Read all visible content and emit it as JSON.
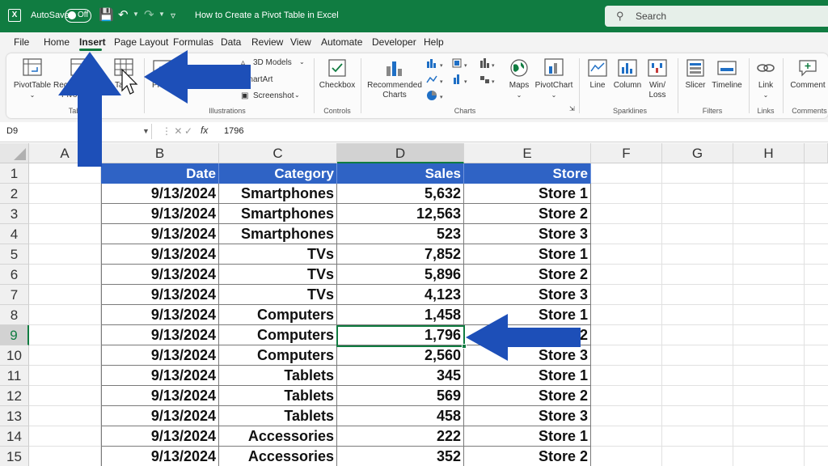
{
  "titlebar": {
    "autosave_label": "AutoSave",
    "toggle_state": "Off",
    "document_title": "How to Create a Pivot Table in Excel",
    "search_placeholder": "Search",
    "accent_color": "#107c41"
  },
  "menu": {
    "tabs": [
      "File",
      "Home",
      "Insert",
      "Page Layout",
      "Formulas",
      "Data",
      "Review",
      "View",
      "Automate",
      "Developer",
      "Help"
    ],
    "active_tab": "Insert"
  },
  "ribbon": {
    "tables": {
      "pivottable": "PivotTable",
      "recommended_pivot_1": "Rec",
      "recommended_pivot_2": "Pivot",
      "table": "Ta",
      "group": "Tab"
    },
    "illustrations": {
      "pictures": "Pi",
      "models_3d": "3D Models",
      "smartart": "SmartArt",
      "screenshot": "Screenshot",
      "group": "Illustrations"
    },
    "controls": {
      "checkbox": "Checkbox",
      "group": "Controls"
    },
    "charts": {
      "recommended_1": "Recommended",
      "recommended_2": "Charts",
      "maps": "Maps",
      "pivotchart": "PivotChart",
      "group": "Charts"
    },
    "sparklines": {
      "line": "Line",
      "column": "Column",
      "winloss_1": "Win/",
      "winloss_2": "Loss",
      "group": "Sparklines"
    },
    "filters": {
      "slicer": "Slicer",
      "timeline": "Timeline",
      "group": "Filters"
    },
    "links": {
      "link": "Link",
      "group": "Links"
    },
    "comments": {
      "comment": "Comment",
      "group": "Comments"
    }
  },
  "formula_bar": {
    "name_box": "D9",
    "fx_label": "fx",
    "value": "1796"
  },
  "grid": {
    "columns": [
      "A",
      "B",
      "C",
      "D",
      "E",
      "F",
      "G",
      "H"
    ],
    "rows": [
      "1",
      "2",
      "3",
      "4",
      "5",
      "6",
      "7",
      "8",
      "9",
      "10",
      "11",
      "12",
      "13",
      "14",
      "15"
    ],
    "selected_column": "D",
    "selected_row": "9"
  },
  "table": {
    "header_color": "#2f63c5",
    "headers": [
      "Date",
      "Category",
      "Sales",
      "Store"
    ],
    "rows": [
      [
        "9/13/2024",
        "Smartphones",
        "5,632",
        "Store 1"
      ],
      [
        "9/13/2024",
        "Smartphones",
        "12,563",
        "Store 2"
      ],
      [
        "9/13/2024",
        "Smartphones",
        "523",
        "Store 3"
      ],
      [
        "9/13/2024",
        "TVs",
        "7,852",
        "Store 1"
      ],
      [
        "9/13/2024",
        "TVs",
        "5,896",
        "Store 2"
      ],
      [
        "9/13/2024",
        "TVs",
        "4,123",
        "Store 3"
      ],
      [
        "9/13/2024",
        "Computers",
        "1,458",
        "Store 1"
      ],
      [
        "9/13/2024",
        "Computers",
        "1,796",
        "Store 2"
      ],
      [
        "9/13/2024",
        "Computers",
        "2,560",
        "Store 3"
      ],
      [
        "9/13/2024",
        "Tablets",
        "345",
        "Store 1"
      ],
      [
        "9/13/2024",
        "Tablets",
        "569",
        "Store 2"
      ],
      [
        "9/13/2024",
        "Tablets",
        "458",
        "Store 3"
      ],
      [
        "9/13/2024",
        "Accessories",
        "222",
        "Store 1"
      ],
      [
        "9/13/2024",
        "Accessories",
        "352",
        "Store 2"
      ]
    ]
  },
  "annotations": {
    "arrow_color": "#1d4fb8"
  }
}
